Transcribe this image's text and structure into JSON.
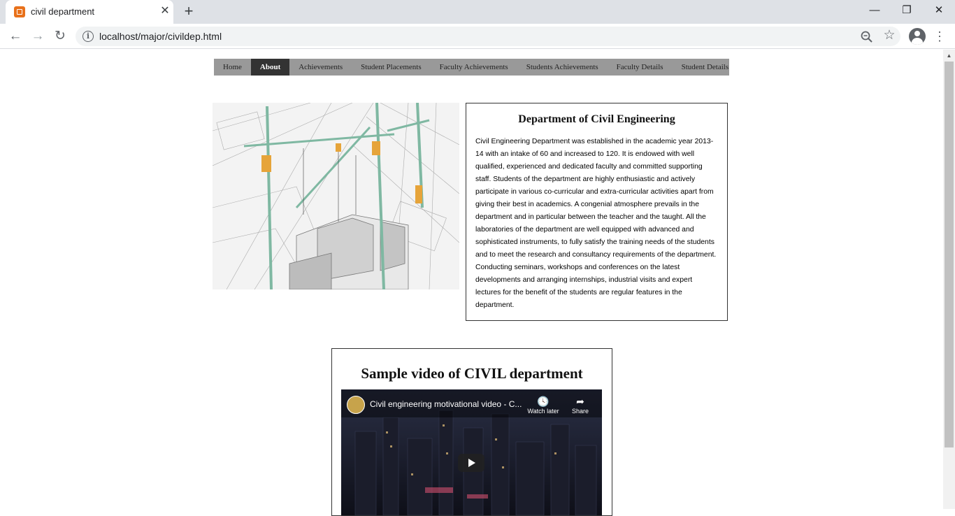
{
  "browser": {
    "tab_title": "civil department",
    "url": "localhost/major/civildep.html"
  },
  "nav": {
    "items": [
      "Home",
      "About",
      "Achievements",
      "Student Placements",
      "Faculty Achievements",
      "Students Achievements",
      "Faculty Details",
      "Student Details"
    ],
    "active": "About"
  },
  "department": {
    "title": "Department of Civil Engineering",
    "description": "Civil Engineering Department was established in the academic year 2013-14 with an intake of 60 and increased to 120. It is endowed with well qualified, experienced and dedicated faculty and committed supporting staff. Students of the department are highly enthusiastic and actively participate in various co-curricular and extra-curricular activities apart from giving their best in academics. A congenial atmosphere prevails in the department and in particular between the teacher and the taught. All the laboratories of the department are well equipped with advanced and sophisticated instruments, to fully satisfy the training needs of the students and to meet the research and consultancy requirements of the department. Conducting seminars, workshops and conferences on the latest developments and arranging internships, industrial visits and expert lectures for the benefit of the students are regular features in the department."
  },
  "video": {
    "heading": "Sample video of CIVIL department",
    "title": "Civil engineering motivational video - C...",
    "watch_later": "Watch later",
    "share": "Share"
  }
}
